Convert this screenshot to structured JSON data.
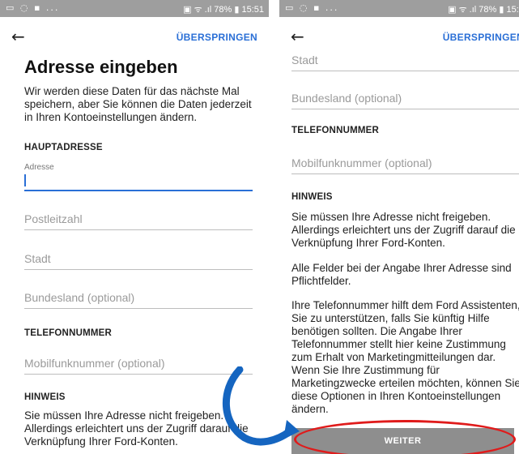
{
  "statusbar": {
    "left_icons": "▭ ◌ ▪ ...",
    "right": "▣ ᯤ .ıl 78% ▮ 15:51"
  },
  "left": {
    "back_glyph": "←",
    "skip": "ÜBERSPRINGEN",
    "title": "Adresse eingeben",
    "intro": "Wir werden diese Daten für das nächste Mal speichern, aber Sie können die Daten jederzeit in Ihren Kontoeinstellungen ändern.",
    "section_main": "HAUPTADRESSE",
    "address_label": "Adresse",
    "postcode": "Postleitzahl",
    "city": "Stadt",
    "state": "Bundesland (optional)",
    "section_phone": "TELEFONNUMMER",
    "phone": "Mobilfunknummer (optional)",
    "section_hint": "HINWEIS",
    "hint1": "Sie müssen Ihre Adresse nicht freigeben. Allerdings erleichtert uns der Zugriff darauf die Verknüpfung Ihrer Ford-Konten."
  },
  "right": {
    "back_glyph": "←",
    "skip": "ÜBERSPRINGEN",
    "city": "Stadt",
    "state": "Bundesland (optional)",
    "section_phone": "TELEFONNUMMER",
    "phone": "Mobilfunknummer (optional)",
    "section_hint": "HINWEIS",
    "hint1": "Sie müssen Ihre Adresse nicht freigeben. Allerdings erleichtert uns der Zugriff darauf die Verknüpfung Ihrer Ford-Konten.",
    "hint2": "Alle Felder bei der Angabe Ihrer Adresse sind Pflichtfelder.",
    "hint3": "Ihre Telefonnummer hilft dem Ford Assistenten, Sie zu unterstützen, falls Sie künftig Hilfe benötigen sollten. Die Angabe Ihrer Telefonnummer stellt hier keine Zustimmung zum Erhalt von Marketingmitteilungen dar. Wenn Sie Ihre Zustimmung für Marketingzwecke erteilen möchten, können Sie diese Optionen in Ihren Kontoeinstellungen ändern.",
    "button": "WEITER"
  },
  "colors": {
    "accent": "#2a6fd6",
    "statusbar": "#9e9e9e",
    "button": "#8e8e8e",
    "highlight": "#e01b1b",
    "arrow": "#1565c0"
  }
}
